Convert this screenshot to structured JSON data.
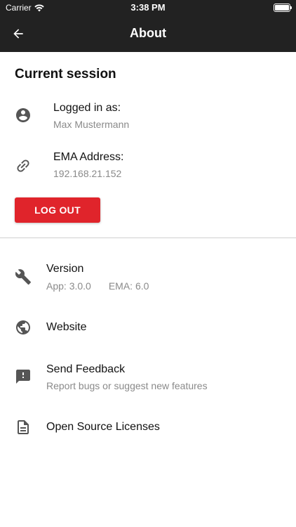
{
  "status_bar": {
    "carrier": "Carrier",
    "time": "3:38 PM"
  },
  "app_bar": {
    "title": "About",
    "back_icon": "arrow-back-icon"
  },
  "session": {
    "title": "Current session",
    "logged_in": {
      "icon": "account-circle-icon",
      "label": "Logged in as:",
      "value": "Max Mustermann"
    },
    "ema_address": {
      "icon": "link-icon",
      "label": "EMA Address:",
      "value": "192.168.21.152"
    },
    "logout_label": "LOG OUT"
  },
  "info": {
    "version": {
      "icon": "wrench-icon",
      "label": "Version",
      "app_version": "App: 3.0.0",
      "ema_version": "EMA: 6.0"
    },
    "website": {
      "icon": "globe-icon",
      "label": "Website"
    },
    "feedback": {
      "icon": "feedback-icon",
      "label": "Send Feedback",
      "sub": "Report bugs or suggest new features"
    },
    "licenses": {
      "icon": "document-icon",
      "label": "Open Source Licenses"
    }
  },
  "colors": {
    "bar_background": "#222222",
    "accent_red": "#e0242b",
    "secondary_text": "#8a8a8a",
    "icon_gray": "#555555"
  }
}
